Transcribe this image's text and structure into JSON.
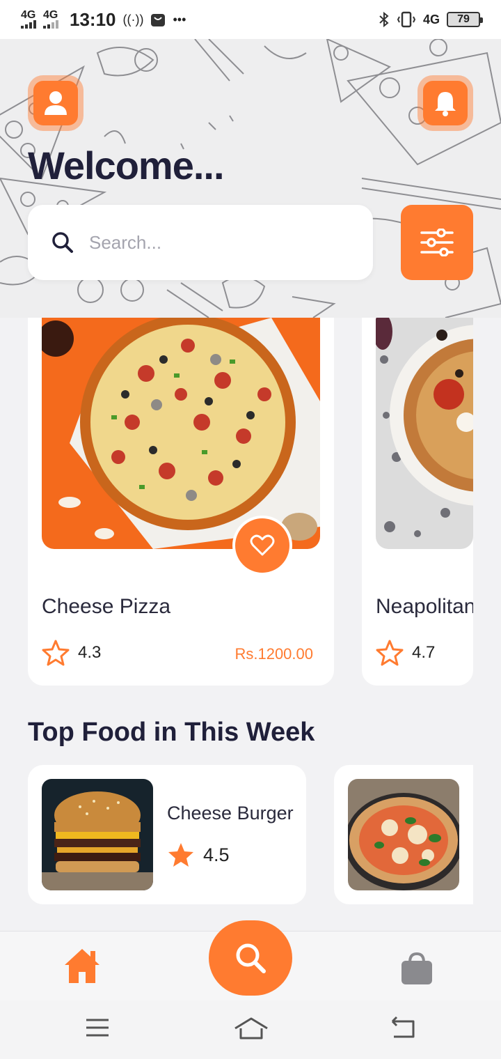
{
  "status_bar": {
    "net1": "4G",
    "net2": "4G",
    "time": "13:10",
    "net3": "4G",
    "battery": "79"
  },
  "header": {
    "title": "Welcome...",
    "search_placeholder": "Search..."
  },
  "featured": [
    {
      "name": "Cheese Pizza",
      "rating": "4.3",
      "price": "Rs.1200.00"
    },
    {
      "name": "Neapolitan",
      "rating": "4.7"
    }
  ],
  "top_food": {
    "title": "Top Food in This Week",
    "items": [
      {
        "name": "Cheese Burger",
        "rating": "4.5"
      }
    ]
  },
  "icons": {
    "profile": "user-icon",
    "notifications": "bell-icon",
    "filter": "sliders-icon",
    "favorite": "heart-icon",
    "rating": "star-icon",
    "home": "home-icon",
    "search": "search-icon",
    "cart": "bag-icon"
  },
  "colors": {
    "accent": "#ff7b30",
    "title": "#20203a",
    "background": "#f2f2f4"
  }
}
